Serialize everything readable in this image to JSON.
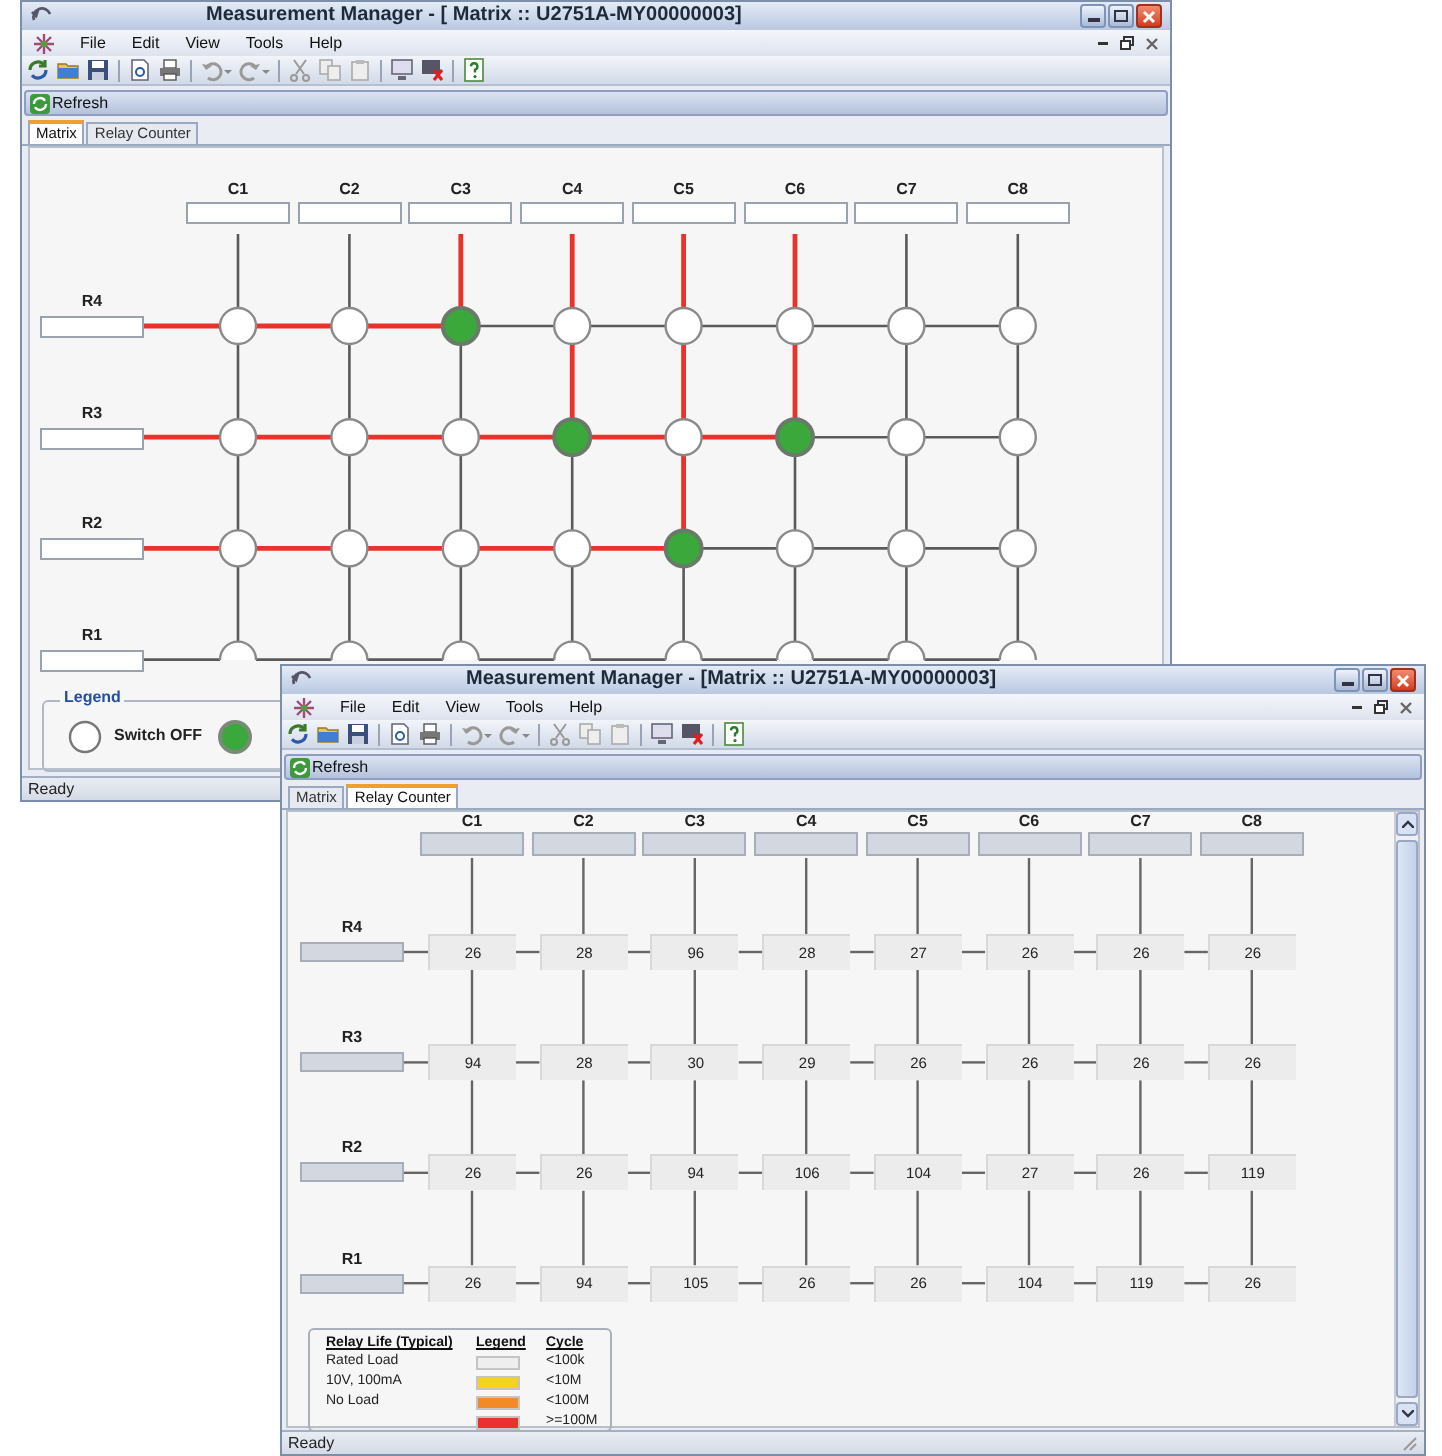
{
  "windows": [
    {
      "kind": "matrix",
      "title": "Measurement Manager - [ Matrix :: U2751A-MY00000003]",
      "menu": [
        "File",
        "Edit",
        "View",
        "Tools",
        "Help"
      ],
      "refresh": "Refresh",
      "tabs": [
        {
          "label": "Matrix",
          "selected": true
        },
        {
          "label": "Relay Counter",
          "selected": false
        }
      ],
      "columns": [
        "C1",
        "C2",
        "C3",
        "C4",
        "C5",
        "C6",
        "C7",
        "C8"
      ],
      "rows": [
        {
          "label": "R4",
          "nodes": [
            {
              "closed": false
            },
            {
              "closed": false
            },
            {
              "closed": true
            },
            {
              "closed": false
            },
            {
              "closed": false
            },
            {
              "closed": false
            },
            {
              "closed": false
            },
            {
              "closed": false
            }
          ]
        },
        {
          "label": "R3",
          "nodes": [
            {
              "closed": false
            },
            {
              "closed": false
            },
            {
              "closed": false
            },
            {
              "closed": true
            },
            {
              "closed": false
            },
            {
              "closed": true
            },
            {
              "closed": false
            },
            {
              "closed": false
            }
          ]
        },
        {
          "label": "R2",
          "nodes": [
            {
              "closed": false
            },
            {
              "closed": false
            },
            {
              "closed": false
            },
            {
              "closed": false
            },
            {
              "closed": true
            },
            {
              "closed": false
            },
            {
              "closed": false
            },
            {
              "closed": false
            }
          ]
        },
        {
          "label": "R1",
          "nodes": [
            {
              "closed": false
            },
            {
              "closed": false
            },
            {
              "closed": false
            },
            {
              "closed": false
            },
            {
              "closed": false
            },
            {
              "closed": false
            },
            {
              "closed": false
            },
            {
              "closed": false
            }
          ]
        }
      ],
      "legend": {
        "title": "Legend",
        "items": [
          {
            "closed": false,
            "label": "Switch OFF"
          },
          {
            "closed": true
          }
        ]
      },
      "status": "Ready"
    },
    {
      "kind": "counter",
      "title": "Measurement Manager - [Matrix :: U2751A-MY00000003]",
      "menu": [
        "File",
        "Edit",
        "View",
        "Tools",
        "Help"
      ],
      "refresh": "Refresh",
      "tabs": [
        {
          "label": "Matrix",
          "selected": false
        },
        {
          "label": "Relay Counter",
          "selected": true
        }
      ],
      "columns": [
        "C1",
        "C2",
        "C3",
        "C4",
        "C5",
        "C6",
        "C7",
        "C8"
      ],
      "rows": [
        {
          "label": "R4",
          "counts": [
            "26",
            "28",
            "96",
            "28",
            "27",
            "26",
            "26",
            "26"
          ]
        },
        {
          "label": "R3",
          "counts": [
            "94",
            "28",
            "30",
            "29",
            "26",
            "26",
            "26",
            "26"
          ]
        },
        {
          "label": "R2",
          "counts": [
            "26",
            "26",
            "94",
            "106",
            "104",
            "27",
            "26",
            "119"
          ]
        },
        {
          "label": "R1",
          "counts": [
            "26",
            "94",
            "105",
            "26",
            "26",
            "104",
            "119",
            "26"
          ]
        }
      ],
      "legend": {
        "headers": [
          "Relay Life (Typical)",
          "Legend",
          "Cycle"
        ],
        "rows": [
          {
            "load": "Rated Load",
            "color": "#eeeeee",
            "cycle": "<100k"
          },
          {
            "load": "10V, 100mA",
            "color": "#f5d31c",
            "cycle": "<10M"
          },
          {
            "load": "No Load",
            "color": "#f28a26",
            "cycle": "<100M"
          },
          {
            "color": "#e8322a",
            "cycle": ">=100M"
          }
        ]
      },
      "status": "Ready"
    }
  ]
}
